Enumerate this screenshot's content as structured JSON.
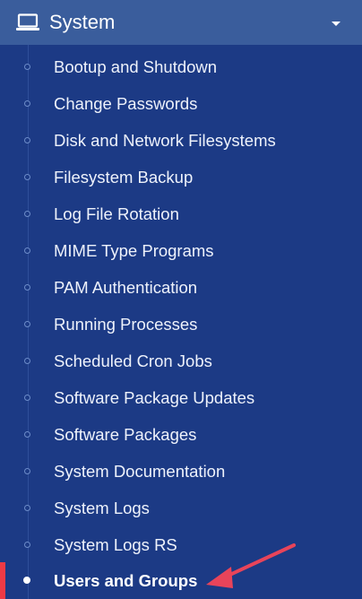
{
  "header": {
    "title": "System",
    "icon": "laptop-icon",
    "toggle_icon": "caret-down-icon"
  },
  "menu": {
    "items": [
      {
        "label": "Bootup and Shutdown"
      },
      {
        "label": "Change Passwords"
      },
      {
        "label": "Disk and Network Filesystems"
      },
      {
        "label": "Filesystem Backup"
      },
      {
        "label": "Log File Rotation"
      },
      {
        "label": "MIME Type Programs"
      },
      {
        "label": "PAM Authentication"
      },
      {
        "label": "Running Processes"
      },
      {
        "label": "Scheduled Cron Jobs"
      },
      {
        "label": "Software Package Updates"
      },
      {
        "label": "Software Packages"
      },
      {
        "label": "System Documentation"
      },
      {
        "label": "System Logs"
      },
      {
        "label": "System Logs RS"
      }
    ],
    "active_item": {
      "label": "Users and Groups"
    }
  },
  "annotation": {
    "type": "arrow",
    "color": "#e8445a",
    "points_to": "Users and Groups"
  },
  "colors": {
    "sidebar_bg": "#1c3a85",
    "header_bg": "#3a5d9c",
    "active_marker": "#ee3a45"
  }
}
